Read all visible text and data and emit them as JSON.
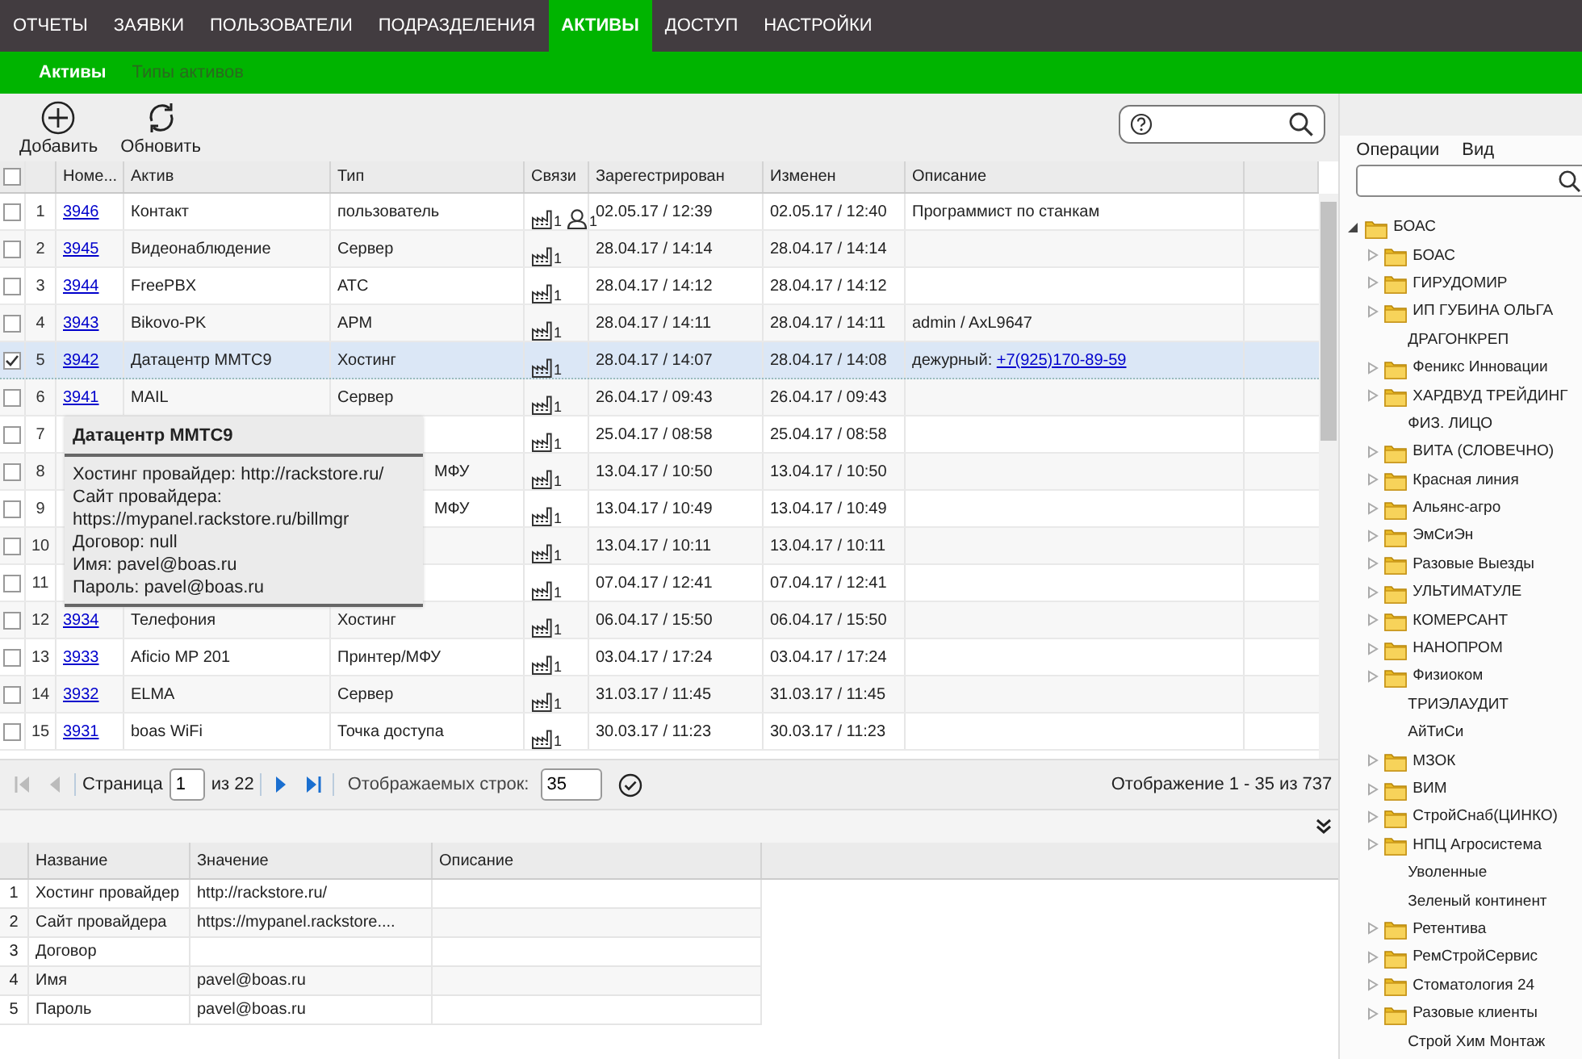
{
  "nav": {
    "tabs": [
      {
        "label": "ОТЧЕТЫ",
        "selected": false
      },
      {
        "label": "ЗАЯВКИ",
        "selected": false
      },
      {
        "label": "ПОЛЬЗОВАТЕЛИ",
        "selected": false
      },
      {
        "label": "ПОДРАЗДЕЛЕНИЯ",
        "selected": false
      },
      {
        "label": "АКТИВЫ",
        "selected": true
      },
      {
        "label": "ДОСТУП",
        "selected": false
      },
      {
        "label": "НАСТРОЙКИ",
        "selected": false
      }
    ]
  },
  "subnav": {
    "tabs": [
      {
        "label": "Активы",
        "selected": true
      },
      {
        "label": "Типы активов",
        "selected": false
      }
    ]
  },
  "toolbar": {
    "buttons": [
      {
        "label": "Добавить",
        "kind": "add"
      },
      {
        "label": "Обновить",
        "kind": "refresh"
      }
    ]
  },
  "grid": {
    "all_checked": false,
    "columns": [
      "Номе...",
      "Актив",
      "Тип",
      "Связи",
      "Зарегестрирован",
      "Изменен",
      "Описание"
    ],
    "rows": [
      {
        "index": "1",
        "checked": false,
        "selected": false,
        "number": "3946",
        "asset": "Контакт",
        "type": "пользователь",
        "links": [
          {
            "kind": "object",
            "count": "1"
          },
          {
            "kind": "user",
            "count": "1"
          }
        ],
        "registered": "02.05.17 / 12:39",
        "changed": "02.05.17 / 12:40",
        "description": "Программист по станкам"
      },
      {
        "index": "2",
        "checked": false,
        "selected": false,
        "number": "3945",
        "asset": "Видеонаблюдение",
        "type": "Сервер",
        "links": [
          {
            "kind": "object",
            "count": "1"
          }
        ],
        "registered": "28.04.17 / 14:14",
        "changed": "28.04.17 / 14:14"
      },
      {
        "index": "3",
        "checked": false,
        "selected": false,
        "number": "3944",
        "asset": "FreePBX",
        "type": "АТС",
        "links": [
          {
            "kind": "object",
            "count": "1"
          }
        ],
        "registered": "28.04.17 / 14:12",
        "changed": "28.04.17 / 14:12"
      },
      {
        "index": "4",
        "checked": false,
        "selected": false,
        "number": "3943",
        "asset": "Bikovo-PK",
        "type": "АРМ",
        "links": [
          {
            "kind": "object",
            "count": "1"
          }
        ],
        "registered": "28.04.17 / 14:11",
        "changed": "28.04.17 / 14:11",
        "description": "admin / AxL9647"
      },
      {
        "index": "5",
        "checked": true,
        "selected": true,
        "number": "3942",
        "asset": "Датацентр ММТС9",
        "type": "Хостинг",
        "links": [
          {
            "kind": "object",
            "count": "1"
          }
        ],
        "registered": "28.04.17 / 14:07",
        "changed": "28.04.17 / 14:08",
        "description": "дежурный:",
        "description_link": "+7(925)170-89-59"
      },
      {
        "index": "6",
        "checked": false,
        "selected": false,
        "number": "3941",
        "asset": "MAIL",
        "type": "Сервер",
        "links": [
          {
            "kind": "object",
            "count": "1"
          }
        ],
        "registered": "26.04.17 / 09:43",
        "changed": "26.04.17 / 09:43"
      },
      {
        "index": "7",
        "checked": false,
        "selected": false,
        "links": [
          {
            "kind": "object",
            "count": "1"
          }
        ],
        "registered": "25.04.17 / 08:58",
        "changed": "25.04.17 / 08:58"
      },
      {
        "index": "8",
        "checked": false,
        "selected": false,
        "type": "МФУ",
        "links": [
          {
            "kind": "object",
            "count": "1"
          }
        ],
        "registered": "13.04.17 / 10:50",
        "changed": "13.04.17 / 10:50"
      },
      {
        "index": "9",
        "checked": false,
        "selected": false,
        "type": "МФУ",
        "links": [
          {
            "kind": "object",
            "count": "1"
          }
        ],
        "registered": "13.04.17 / 10:49",
        "changed": "13.04.17 / 10:49"
      },
      {
        "index": "10",
        "checked": false,
        "selected": false,
        "links": [
          {
            "kind": "object",
            "count": "1"
          }
        ],
        "registered": "13.04.17 / 10:11",
        "changed": "13.04.17 / 10:11"
      },
      {
        "index": "11",
        "checked": false,
        "selected": false,
        "links": [
          {
            "kind": "object",
            "count": "1"
          }
        ],
        "registered": "07.04.17 / 12:41",
        "changed": "07.04.17 / 12:41"
      },
      {
        "index": "12",
        "checked": false,
        "selected": false,
        "number": "3934",
        "asset": "Телефония",
        "type": "Хостинг",
        "links": [
          {
            "kind": "object",
            "count": "1"
          }
        ],
        "registered": "06.04.17 / 15:50",
        "changed": "06.04.17 / 15:50"
      },
      {
        "index": "13",
        "checked": false,
        "selected": false,
        "number": "3933",
        "asset": "Aficio MP 201",
        "type": "Принтер/МФУ",
        "links": [
          {
            "kind": "object",
            "count": "1"
          }
        ],
        "registered": "03.04.17 / 17:24",
        "changed": "03.04.17 / 17:24"
      },
      {
        "index": "14",
        "checked": false,
        "selected": false,
        "number": "3932",
        "asset": "ELMA",
        "type": "Сервер",
        "links": [
          {
            "kind": "object",
            "count": "1"
          }
        ],
        "registered": "31.03.17 / 11:45",
        "changed": "31.03.17 / 11:45"
      },
      {
        "index": "15",
        "checked": false,
        "selected": false,
        "number": "3931",
        "asset": "boas WiFi",
        "type": "Точка доступа",
        "links": [
          {
            "kind": "object",
            "count": "1"
          }
        ],
        "registered": "30.03.17 / 11:23",
        "changed": "30.03.17 / 11:23"
      }
    ]
  },
  "tooltip": {
    "title": "Датацентр ММТС9",
    "lines": [
      "Хостинг провайдер: http://rackstore.ru/",
      "Сайт провайдера:",
      "https://mypanel.rackstore.ru/billmgr",
      "Договор: null",
      "Имя: pavel@boas.ru",
      "Пароль: pavel@boas.ru"
    ]
  },
  "pager": {
    "nav_back": [
      {
        "kind": "first",
        "disabled": true
      },
      {
        "kind": "prev",
        "disabled": true
      }
    ],
    "page_label": "Страница",
    "page": "1",
    "page_total": "из 22",
    "nav_forward": [
      {
        "kind": "next",
        "disabled": false
      },
      {
        "kind": "last",
        "disabled": false
      }
    ],
    "rows_label": "Отображаемых строк:",
    "rows": "35",
    "summary": "Отображение 1 - 35 из 737"
  },
  "details": {
    "columns": [
      "Название",
      "Значение",
      "Описание"
    ],
    "rows": [
      {
        "index": "1",
        "name": "Хостинг провайдер",
        "value": "http://rackstore.ru/"
      },
      {
        "index": "2",
        "name": "Сайт провайдера",
        "value": "https://mypanel.rackstore...."
      },
      {
        "index": "3",
        "name": "Договор"
      },
      {
        "index": "4",
        "name": "Имя",
        "value": "pavel@boas.ru"
      },
      {
        "index": "5",
        "name": "Пароль",
        "value": "pavel@boas.ru"
      }
    ]
  },
  "sidebar": {
    "menu": [
      "Операции",
      "Вид"
    ],
    "tree": [
      {
        "label": "БОАС",
        "kind": "folder",
        "expanded": true,
        "children": [
          {
            "label": "БОАС",
            "kind": "folder",
            "expanded": false
          },
          {
            "label": "ГИРУДОМИР",
            "kind": "folder",
            "expanded": false
          },
          {
            "label": "ИП ГУБИНА ОЛЬГА",
            "kind": "folder",
            "expanded": false
          },
          {
            "label": "ДРАГОНКРЕП",
            "kind": "plain"
          },
          {
            "label": "Феникс Инновации",
            "kind": "folder",
            "expanded": false
          },
          {
            "label": "ХАРДВУД ТРЕЙДИНГ",
            "kind": "folder",
            "expanded": false
          },
          {
            "label": "ФИЗ. ЛИЦО",
            "kind": "plain"
          },
          {
            "label": "ВИТА (СЛОВЕЧНО)",
            "kind": "folder",
            "expanded": false
          },
          {
            "label": "Красная линия",
            "kind": "folder",
            "expanded": false
          },
          {
            "label": "Альянс-агро",
            "kind": "folder",
            "expanded": false
          },
          {
            "label": "ЭмСиЭн",
            "kind": "folder",
            "expanded": false
          },
          {
            "label": "Разовые Выезды",
            "kind": "folder",
            "expanded": false
          },
          {
            "label": "УЛЬТИМАТУЛЕ",
            "kind": "folder",
            "expanded": false
          },
          {
            "label": "КОМЕРСАНТ",
            "kind": "folder",
            "expanded": false
          },
          {
            "label": "НАНОПРОМ",
            "kind": "folder",
            "expanded": false
          },
          {
            "label": "Физиоком",
            "kind": "folder",
            "expanded": false
          },
          {
            "label": "ТРИЭЛАУДИТ",
            "kind": "plain"
          },
          {
            "label": "АйТиСи",
            "kind": "plain"
          },
          {
            "label": "МЗОК",
            "kind": "folder",
            "expanded": false
          },
          {
            "label": "ВИМ",
            "kind": "folder",
            "expanded": false
          },
          {
            "label": "СтройСнаб(ЦИНКО)",
            "kind": "folder",
            "expanded": false
          },
          {
            "label": "НПЦ Агросистема",
            "kind": "folder",
            "expanded": false
          },
          {
            "label": "Уволенные",
            "kind": "plain"
          },
          {
            "label": "Зеленый континент",
            "kind": "plain"
          },
          {
            "label": "Ретентива",
            "kind": "folder",
            "expanded": false
          },
          {
            "label": "РемСтройСервис",
            "kind": "folder",
            "expanded": false
          },
          {
            "label": "Стоматология 24",
            "kind": "folder",
            "expanded": false
          },
          {
            "label": "Разовые клиенты",
            "kind": "folder",
            "expanded": false
          },
          {
            "label": "Строй Хим Монтаж",
            "kind": "plain"
          }
        ]
      }
    ]
  }
}
